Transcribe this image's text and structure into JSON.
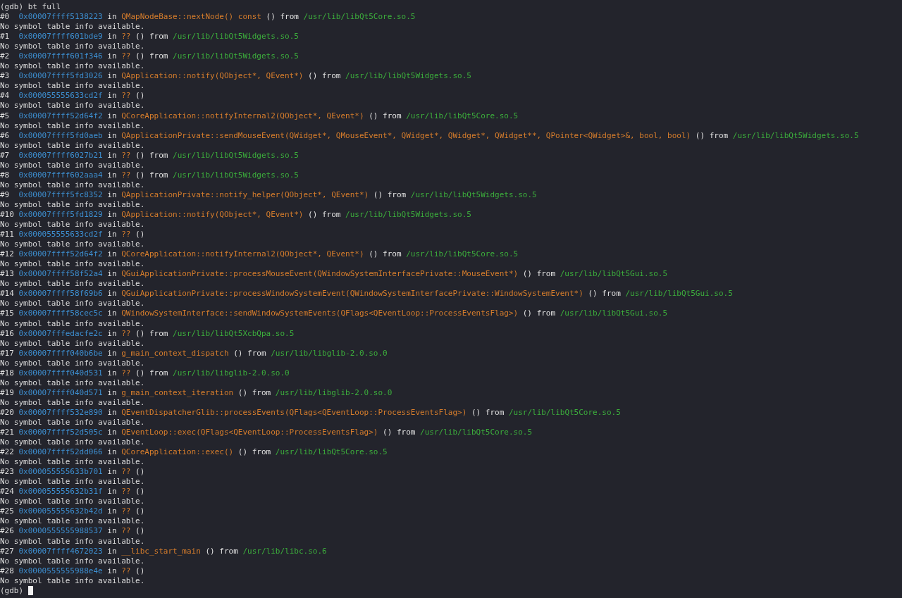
{
  "terminal": {
    "command_line": {
      "prompt": "(gdb)",
      "command": "bt full"
    },
    "frames": [
      {
        "number": "#0",
        "address": "0x00007ffff5138223",
        "in": "in",
        "function": "QMapNodeBase::nextNode() const",
        "args": "()",
        "from": "from",
        "library": "/usr/lib/libQt5Core.so.5",
        "info": "No symbol table info available."
      },
      {
        "number": "#1",
        "address": "0x00007ffff601bde9",
        "in": "in",
        "function": "??",
        "args": "()",
        "from": "from",
        "library": "/usr/lib/libQt5Widgets.so.5",
        "info": "No symbol table info available."
      },
      {
        "number": "#2",
        "address": "0x00007ffff601f346",
        "in": "in",
        "function": "??",
        "args": "()",
        "from": "from",
        "library": "/usr/lib/libQt5Widgets.so.5",
        "info": "No symbol table info available."
      },
      {
        "number": "#3",
        "address": "0x00007ffff5fd3026",
        "in": "in",
        "function": "QApplication::notify(QObject*, QEvent*)",
        "args": "()",
        "from": "from",
        "library": "/usr/lib/libQt5Widgets.so.5",
        "info": "No symbol table info available."
      },
      {
        "number": "#4",
        "address": "0x000055555633cd2f",
        "in": "in",
        "function": "??",
        "args": "()",
        "info": "No symbol table info available."
      },
      {
        "number": "#5",
        "address": "0x00007ffff52d64f2",
        "in": "in",
        "function": "QCoreApplication::notifyInternal2(QObject*, QEvent*)",
        "args": "()",
        "from": "from",
        "library": "/usr/lib/libQt5Core.so.5",
        "info": "No symbol table info available."
      },
      {
        "number": "#6",
        "address": "0x00007ffff5fd0aeb",
        "in": "in",
        "function": "QApplicationPrivate::sendMouseEvent(QWidget*, QMouseEvent*, QWidget*, QWidget*, QWidget**, QPointer<QWidget>&, bool, bool)",
        "args": "()",
        "from": "from",
        "library": "/usr/lib/libQt5Widgets.so.5",
        "info": "No symbol table info available."
      },
      {
        "number": "#7",
        "address": "0x00007ffff6027b21",
        "in": "in",
        "function": "??",
        "args": "()",
        "from": "from",
        "library": "/usr/lib/libQt5Widgets.so.5",
        "info": "No symbol table info available."
      },
      {
        "number": "#8",
        "address": "0x00007ffff602aaa4",
        "in": "in",
        "function": "??",
        "args": "()",
        "from": "from",
        "library": "/usr/lib/libQt5Widgets.so.5",
        "info": "No symbol table info available."
      },
      {
        "number": "#9",
        "address": "0x00007ffff5fc8352",
        "in": "in",
        "function": "QApplicationPrivate::notify_helper(QObject*, QEvent*)",
        "args": "()",
        "from": "from",
        "library": "/usr/lib/libQt5Widgets.so.5",
        "info": "No symbol table info available."
      },
      {
        "number": "#10",
        "address": "0x00007ffff5fd1829",
        "in": "in",
        "function": "QApplication::notify(QObject*, QEvent*)",
        "args": "()",
        "from": "from",
        "library": "/usr/lib/libQt5Widgets.so.5",
        "info": "No symbol table info available."
      },
      {
        "number": "#11",
        "address": "0x000055555633cd2f",
        "in": "in",
        "function": "??",
        "args": "()",
        "info": "No symbol table info available."
      },
      {
        "number": "#12",
        "address": "0x00007ffff52d64f2",
        "in": "in",
        "function": "QCoreApplication::notifyInternal2(QObject*, QEvent*)",
        "args": "()",
        "from": "from",
        "library": "/usr/lib/libQt5Core.so.5",
        "info": "No symbol table info available."
      },
      {
        "number": "#13",
        "address": "0x00007ffff58f52a4",
        "in": "in",
        "function": "QGuiApplicationPrivate::processMouseEvent(QWindowSystemInterfacePrivate::MouseEvent*)",
        "args": "()",
        "from": "from",
        "library": "/usr/lib/libQt5Gui.so.5",
        "info": "No symbol table info available."
      },
      {
        "number": "#14",
        "address": "0x00007ffff58f69b6",
        "in": "in",
        "function": "QGuiApplicationPrivate::processWindowSystemEvent(QWindowSystemInterfacePrivate::WindowSystemEvent*)",
        "args": "()",
        "from": "from",
        "library": "/usr/lib/libQt5Gui.so.5",
        "info": "No symbol table info available."
      },
      {
        "number": "#15",
        "address": "0x00007ffff58cec5c",
        "in": "in",
        "function": "QWindowSystemInterface::sendWindowSystemEvents(QFlags<QEventLoop::ProcessEventsFlag>)",
        "args": "()",
        "from": "from",
        "library": "/usr/lib/libQt5Gui.so.5",
        "info": "No symbol table info available."
      },
      {
        "number": "#16",
        "address": "0x00007fffedacfe2c",
        "in": "in",
        "function": "??",
        "args": "()",
        "from": "from",
        "library": "/usr/lib/libQt5XcbQpa.so.5",
        "info": "No symbol table info available."
      },
      {
        "number": "#17",
        "address": "0x00007ffff040b6be",
        "in": "in",
        "function": "g_main_context_dispatch",
        "args": "()",
        "from": "from",
        "library": "/usr/lib/libglib-2.0.so.0",
        "info": "No symbol table info available."
      },
      {
        "number": "#18",
        "address": "0x00007ffff040d531",
        "in": "in",
        "function": "??",
        "args": "()",
        "from": "from",
        "library": "/usr/lib/libglib-2.0.so.0",
        "info": "No symbol table info available."
      },
      {
        "number": "#19",
        "address": "0x00007ffff040d571",
        "in": "in",
        "function": "g_main_context_iteration",
        "args": "()",
        "from": "from",
        "library": "/usr/lib/libglib-2.0.so.0",
        "info": "No symbol table info available."
      },
      {
        "number": "#20",
        "address": "0x00007ffff532e890",
        "in": "in",
        "function": "QEventDispatcherGlib::processEvents(QFlags<QEventLoop::ProcessEventsFlag>)",
        "args": "()",
        "from": "from",
        "library": "/usr/lib/libQt5Core.so.5",
        "info": "No symbol table info available."
      },
      {
        "number": "#21",
        "address": "0x00007ffff52d505c",
        "in": "in",
        "function": "QEventLoop::exec(QFlags<QEventLoop::ProcessEventsFlag>)",
        "args": "()",
        "from": "from",
        "library": "/usr/lib/libQt5Core.so.5",
        "info": "No symbol table info available."
      },
      {
        "number": "#22",
        "address": "0x00007ffff52dd066",
        "in": "in",
        "function": "QCoreApplication::exec()",
        "args": "()",
        "from": "from",
        "library": "/usr/lib/libQt5Core.so.5",
        "info": "No symbol table info available."
      },
      {
        "number": "#23",
        "address": "0x000055555633b701",
        "in": "in",
        "function": "??",
        "args": "()",
        "info": "No symbol table info available."
      },
      {
        "number": "#24",
        "address": "0x000055555632b31f",
        "in": "in",
        "function": "??",
        "args": "()",
        "info": "No symbol table info available."
      },
      {
        "number": "#25",
        "address": "0x000055555632b42d",
        "in": "in",
        "function": "??",
        "args": "()",
        "info": "No symbol table info available."
      },
      {
        "number": "#26",
        "address": "0x0000555555988537",
        "in": "in",
        "function": "??",
        "args": "()",
        "info": "No symbol table info available."
      },
      {
        "number": "#27",
        "address": "0x00007ffff4672023",
        "in": "in",
        "function": "__libc_start_main",
        "args": "()",
        "from": "from",
        "library": "/usr/lib/libc.so.6",
        "info": "No symbol table info available."
      },
      {
        "number": "#28",
        "address": "0x0000555555988e4e",
        "in": "in",
        "function": "??",
        "args": "()",
        "info": "No symbol table info available."
      }
    ],
    "prompt": "(gdb)"
  }
}
